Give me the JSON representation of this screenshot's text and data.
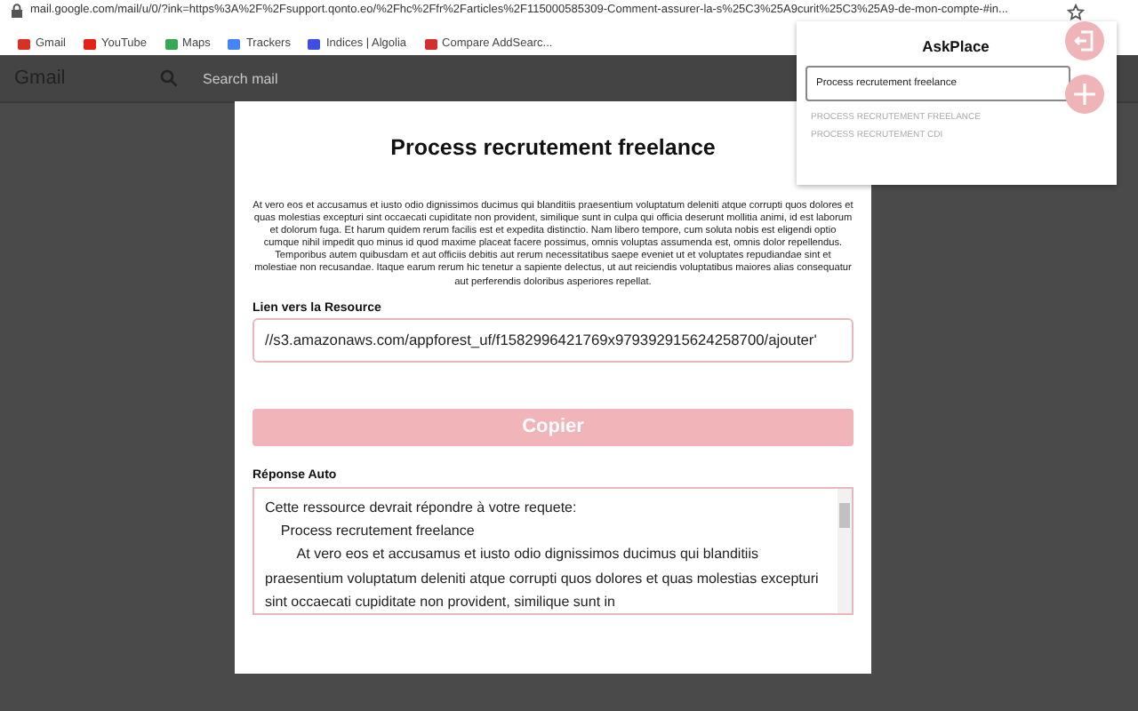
{
  "browser": {
    "url": "mail.google.com/mail/u/0/?ink=https%3A%2F%2Fsupport.qonto.eo/%2Fhc%2Ffr%2Farticles%2F115000585309-Comment-assurer-la-s%25C3%25A9curit%25C3%25A9-de-mon-compte-#in...",
    "bookmarks": [
      {
        "label": "Gmail",
        "color": "#d93025"
      },
      {
        "label": "YouTube",
        "color": "#e62117"
      },
      {
        "label": "Maps",
        "color": "#34a853"
      },
      {
        "label": "Trackers",
        "color": "#4285f4"
      },
      {
        "label": "Indices | Algolia",
        "color": "#3c4fe0"
      },
      {
        "label": "Compare AddSearc...",
        "color": "#d32f2f"
      }
    ]
  },
  "gmail": {
    "logo": "Gmail",
    "search": {
      "placeholder": "Search mail"
    }
  },
  "modal": {
    "title": "Process recrutement freelance",
    "description": "At vero eos et accusamus et iusto odio dignissimos ducimus qui blanditiis praesentium voluptatum deleniti atque corrupti quos dolores et quas molestias excepturi sint occaecati cupiditate non provident, similique sunt in culpa qui officia deserunt mollitia animi, id est laborum et dolorum fuga. Et harum quidem rerum facilis est et expedita distinctio. Nam libero tempore, cum soluta nobis est eligendi optio cumque nihil impedit quo minus id quod maxime placeat facere possimus, omnis voluptas assumenda est, omnis dolor repellendus. Temporibus autem quibusdam et aut officiis debitis aut rerum necessitatibus saepe eveniet ut et voluptates repudiandae sint et molestiae non recusandae. Itaque earum rerum hic tenetur a sapiente delectus, ut aut reiciendis voluptatibus maiores alias consequatur aut perferendis doloribus asperiores repellat.",
    "link_label": "Lien vers la Resource",
    "link_value": "//s3.amazonaws.com/appforest_uf/f1582996421769x979392915624258700/ajouter'",
    "copy_button": "Copier",
    "reply_label": "Réponse Auto",
    "reply_value": "Cette ressource devrait répondre à votre requete:\n\tProcess recrutement freelance\n\t\tAt vero eos et accusamus et iusto odio dignissimos ducimus qui blanditiis praesentium voluptatum deleniti atque corrupti quos dolores et quas molestias excepturi sint occaecati cupiditate non provident, similique sunt in"
  },
  "popup": {
    "title": "AskPlace",
    "search_value": "Process recrutement freelance",
    "suggestions": [
      "PROCESS RECRUTEMENT FREELANCE",
      "PROCESS RECRUTEMENT CDI"
    ]
  }
}
